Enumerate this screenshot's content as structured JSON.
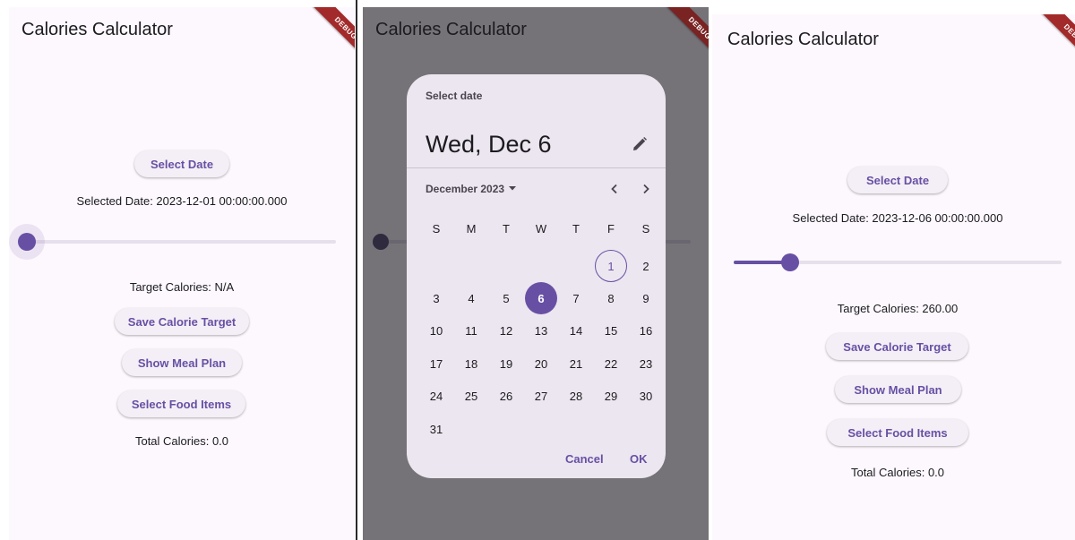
{
  "colors": {
    "primary": "#6750a4",
    "surface": "#fdf8fd",
    "scrim": "#757378",
    "dialog": "#ece6f0",
    "debug_ribbon": "#a32a2a"
  },
  "panel1": {
    "title": "Calories Calculator",
    "debug": "DEBUG",
    "select_date": "Select Date",
    "selected_date": "Selected Date: 2023-12-01 00:00:00.000",
    "slider_value": 0.0,
    "target": "Target Calories: N/A",
    "save": "Save Calorie Target",
    "meal": "Show Meal Plan",
    "food": "Select Food Items",
    "total": "Total Calories: 0.0"
  },
  "panel2": {
    "title": "Calories Calculator",
    "debug": "DEBUG",
    "slider_value": 0.0,
    "date_picker": {
      "header": "Select date",
      "headline": "Wed, Dec 6",
      "edit_icon": "pencil-icon",
      "month_label": "December 2023",
      "weekdays": [
        "S",
        "M",
        "T",
        "W",
        "T",
        "F",
        "S"
      ],
      "days": [
        "1",
        "2",
        "3",
        "4",
        "5",
        "6",
        "7",
        "8",
        "9",
        "10",
        "11",
        "12",
        "13",
        "14",
        "15",
        "16",
        "17",
        "18",
        "19",
        "20",
        "21",
        "22",
        "23",
        "24",
        "25",
        "26",
        "27",
        "28",
        "29",
        "30",
        "31"
      ],
      "first_day_col": 5,
      "today": "1",
      "selected": "6",
      "cancel": "Cancel",
      "ok": "OK"
    }
  },
  "panel3": {
    "title": "Calories Calculator",
    "debug": "DEBUG",
    "select_date": "Select Date",
    "selected_date": "Selected Date: 2023-12-06 00:00:00.000",
    "slider_value": 0.175,
    "target": "Target Calories: 260.00",
    "save": "Save Calorie Target",
    "meal": "Show Meal Plan",
    "food": "Select Food Items",
    "total": "Total Calories: 0.0"
  }
}
